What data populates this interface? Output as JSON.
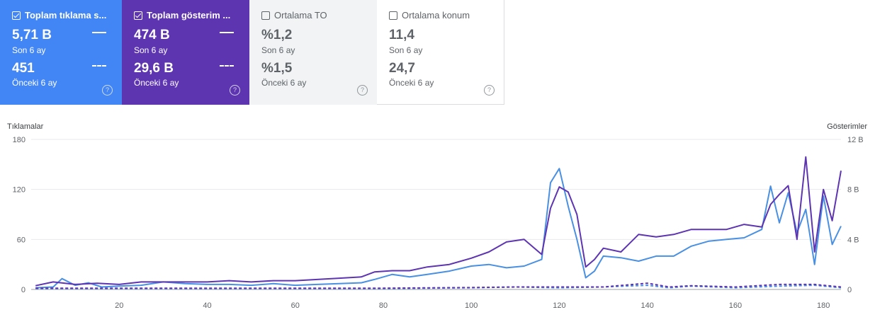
{
  "cards": [
    {
      "label": "Toplam tıklama s...",
      "checked": true,
      "value1": "5,71 B",
      "sub1": "Son 6 ay",
      "value2": "451",
      "sub2": "Önceki 6 ay",
      "help": "?"
    },
    {
      "label": "Toplam gösterim ...",
      "checked": true,
      "value1": "474 B",
      "sub1": "Son 6 ay",
      "value2": "29,6 B",
      "sub2": "Önceki 6 ay",
      "help": "?"
    },
    {
      "label": "Ortalama TO",
      "checked": false,
      "value1": "%1,2",
      "sub1": "Son 6 ay",
      "value2": "%1,5",
      "sub2": "Önceki 6 ay",
      "help": "?"
    },
    {
      "label": "Ortalama konum",
      "checked": false,
      "value1": "11,4",
      "sub1": "Son 6 ay",
      "value2": "24,7",
      "sub2": "Önceki 6 ay",
      "help": "?"
    }
  ],
  "colors": {
    "clicks": "#4a90e2",
    "impressions": "#5e35b1",
    "cardClicks": "#4285f4",
    "cardImpressions": "#5e35b1"
  },
  "chart_data": {
    "type": "line",
    "left_axis_title": "Tıklamalar",
    "right_axis_title": "Gösterimler",
    "left_ticks": [
      "180",
      "120",
      "60",
      "0"
    ],
    "right_ticks": [
      "12 B",
      "8 B",
      "4 B",
      "0"
    ],
    "x_ticks": [
      "20",
      "40",
      "60",
      "80",
      "100",
      "120",
      "140",
      "160",
      "180"
    ],
    "ylim_left": [
      0,
      180
    ],
    "ylim_right": [
      0,
      12
    ],
    "xlim": [
      0,
      184
    ],
    "grid": true,
    "series": [
      {
        "name": "Toplam tıklama (Son 6 ay)",
        "axis": "left",
        "style": "solid",
        "color": "#4a90e2",
        "x": [
          1,
          5,
          7,
          10,
          13,
          16,
          20,
          25,
          30,
          35,
          40,
          45,
          50,
          55,
          60,
          65,
          70,
          75,
          78,
          82,
          86,
          90,
          95,
          100,
          104,
          108,
          112,
          116,
          118,
          120,
          122,
          124,
          126,
          128,
          130,
          134,
          138,
          142,
          146,
          150,
          154,
          158,
          162,
          166,
          168,
          170,
          172,
          174,
          176,
          178,
          180,
          182,
          184
        ],
        "y": [
          2,
          3,
          13,
          5,
          8,
          3,
          4,
          5,
          9,
          7,
          6,
          6,
          5,
          7,
          5,
          6,
          7,
          8,
          12,
          18,
          15,
          18,
          22,
          28,
          30,
          26,
          28,
          36,
          128,
          145,
          100,
          60,
          14,
          22,
          40,
          38,
          34,
          40,
          40,
          52,
          58,
          60,
          62,
          72,
          124,
          80,
          116,
          68,
          96,
          30,
          112,
          54,
          76
        ]
      },
      {
        "name": "Toplam gösterim (Son 6 ay)",
        "axis": "right",
        "style": "solid",
        "color": "#5e35b1",
        "x": [
          1,
          5,
          10,
          15,
          20,
          25,
          30,
          35,
          40,
          45,
          50,
          55,
          60,
          65,
          70,
          75,
          78,
          82,
          86,
          90,
          95,
          100,
          104,
          108,
          112,
          116,
          118,
          120,
          122,
          124,
          126,
          128,
          130,
          134,
          138,
          142,
          146,
          150,
          154,
          158,
          162,
          166,
          168,
          170,
          172,
          174,
          176,
          178,
          180,
          182,
          184
        ],
        "y": [
          0.3,
          0.6,
          0.4,
          0.5,
          0.4,
          0.6,
          0.6,
          0.6,
          0.6,
          0.7,
          0.6,
          0.7,
          0.7,
          0.8,
          0.9,
          1.0,
          1.4,
          1.5,
          1.5,
          1.8,
          2.0,
          2.5,
          3.0,
          3.8,
          4.0,
          2.8,
          6.5,
          8.2,
          7.8,
          6.0,
          1.8,
          2.4,
          3.3,
          3.0,
          4.4,
          4.2,
          4.4,
          4.8,
          4.8,
          4.8,
          5.2,
          5.0,
          6.8,
          7.6,
          8.3,
          4.0,
          10.6,
          3.0,
          8.0,
          5.5,
          9.5
        ]
      },
      {
        "name": "Toplam tıklama (Önceki 6 ay)",
        "axis": "left",
        "style": "dashed",
        "color": "#4a90e2",
        "x": [
          1,
          20,
          40,
          60,
          80,
          100,
          110,
          120,
          130,
          140,
          145,
          150,
          160,
          170,
          178,
          184
        ],
        "y": [
          1,
          1,
          1,
          1,
          1,
          2,
          3,
          2,
          3,
          5,
          2,
          4,
          2,
          4,
          5,
          2
        ]
      },
      {
        "name": "Toplam gösterim (Önceki 6 ay)",
        "axis": "right",
        "style": "dashed",
        "color": "#5e35b1",
        "x": [
          1,
          20,
          40,
          60,
          80,
          100,
          110,
          120,
          130,
          140,
          145,
          150,
          160,
          170,
          178,
          184
        ],
        "y": [
          0.1,
          0.1,
          0.1,
          0.1,
          0.1,
          0.15,
          0.2,
          0.2,
          0.2,
          0.5,
          0.2,
          0.3,
          0.2,
          0.4,
          0.4,
          0.2
        ]
      }
    ]
  }
}
